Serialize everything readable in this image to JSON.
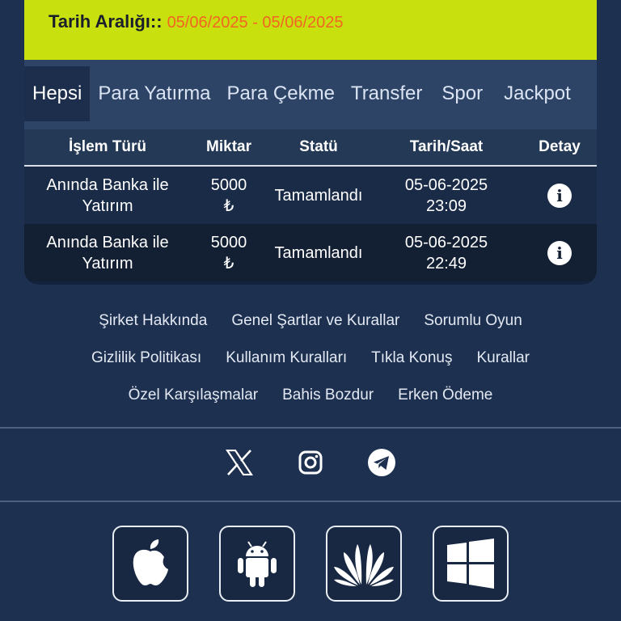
{
  "date_filter": {
    "label": "Tarih Aralığı::",
    "range": "05/06/2025 - 05/06/2025"
  },
  "tabs": [
    {
      "label": "Hepsi",
      "active": true
    },
    {
      "label": "Para Yatırma",
      "active": false
    },
    {
      "label": "Para Çekme",
      "active": false
    },
    {
      "label": "Transfer",
      "active": false
    },
    {
      "label": "Spor",
      "active": false
    },
    {
      "label": "Jackpot",
      "active": false
    }
  ],
  "table": {
    "headers": [
      "İşlem Türü",
      "Miktar",
      "Statü",
      "Tarih/Saat",
      "Detay"
    ],
    "rows": [
      {
        "type_line1": "Anında Banka ile",
        "type_line2": "Yatırım",
        "amount": "5000",
        "currency": "₺",
        "status": "Tamamlandı",
        "date": "05-06-2025",
        "time": "23:09",
        "detail_icon": "info-icon"
      },
      {
        "type_line1": "Anında Banka ile",
        "type_line2": "Yatırım",
        "amount": "5000",
        "currency": "₺",
        "status": "Tamamlandı",
        "date": "05-06-2025",
        "time": "22:49",
        "detail_icon": "info-icon"
      }
    ]
  },
  "footer": {
    "links_row1": [
      "Şirket Hakkında",
      "Genel Şartlar ve Kurallar",
      "Sorumlu Oyun"
    ],
    "links_row2": [
      "Gizlilik Politikası",
      "Kullanım Kuralları",
      "Tıkla Konuş",
      "Kurallar"
    ],
    "links_row3": [
      "Özel Karşılaşmalar",
      "Bahis Bozdur",
      "Erken Ödeme"
    ],
    "social_icons": [
      "x-icon",
      "instagram-icon",
      "telegram-icon"
    ],
    "app_icons": [
      "apple-icon",
      "android-icon",
      "huawei-icon",
      "windows-icon"
    ]
  },
  "colors": {
    "background": "#1e3050",
    "accent": "#c9e00f",
    "date_range": "#f26522"
  }
}
